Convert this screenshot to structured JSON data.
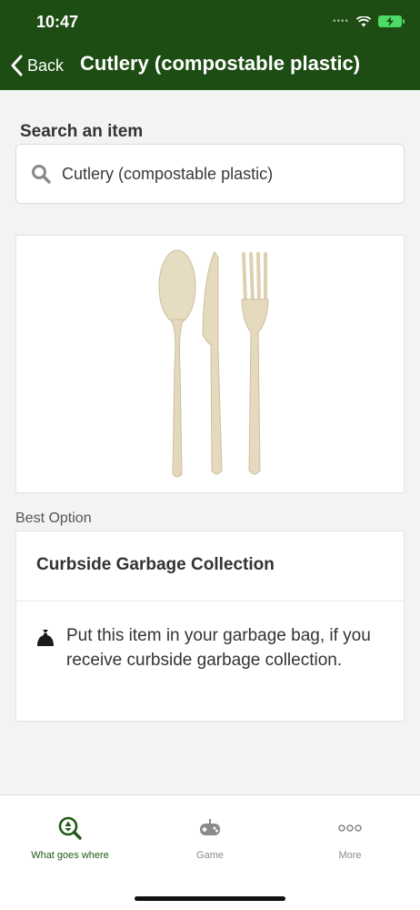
{
  "status_bar": {
    "time": "10:47"
  },
  "header": {
    "back_label": "Back",
    "title": "Cutlery (compostable plastic)"
  },
  "search": {
    "label": "Search an item",
    "value": "Cutlery (compostable plastic)"
  },
  "result": {
    "section_label": "Best Option",
    "option_title": "Curbside Garbage Collection",
    "option_description": "Put this item in your garbage bag, if you receive curbside garbage collection."
  },
  "tabs": [
    {
      "label": "What goes where",
      "icon": "recycle-search-icon",
      "active": true
    },
    {
      "label": "Game",
      "icon": "game-controller-icon",
      "active": false
    },
    {
      "label": "More",
      "icon": "more-icon",
      "active": false
    }
  ],
  "colors": {
    "header_bg": "#1e4d14",
    "active_tab": "#1e5a14",
    "battery": "#4cd964"
  }
}
